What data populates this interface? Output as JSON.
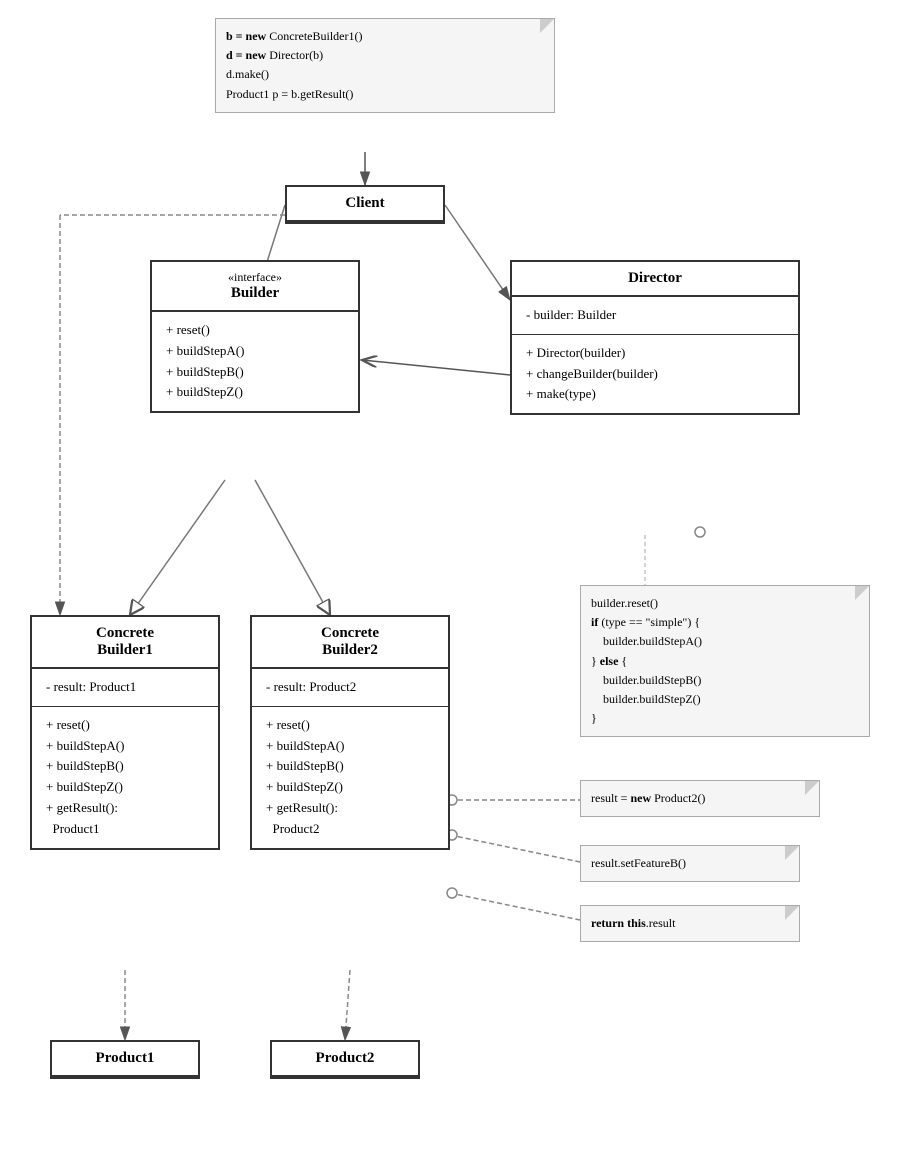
{
  "client": {
    "label": "Client"
  },
  "director": {
    "label": "Director",
    "field": "- builder: Builder",
    "methods": [
      "+ Director(builder)",
      "+ changeBuilder(builder)",
      "+ make(type)"
    ]
  },
  "builder": {
    "stereotype": "«interface»",
    "label": "Builder",
    "methods": [
      "+ reset()",
      "+ buildStepA()",
      "+ buildStepB()",
      "+ buildStepZ()"
    ]
  },
  "cb1": {
    "label": "Concrete\nBuilder1",
    "field": "- result: Product1",
    "methods": [
      "+ reset()",
      "+ buildStepA()",
      "+ buildStepB()",
      "+ buildStepZ()",
      "+ getResult():\n  Product1"
    ]
  },
  "cb2": {
    "label": "Concrete\nBuilder2",
    "field": "- result: Product2",
    "methods": [
      "+ reset()",
      "+ buildStepA()",
      "+ buildStepB()",
      "+ buildStepZ()",
      "+ getResult():\n  Product2"
    ]
  },
  "product1": {
    "label": "Product1"
  },
  "product2": {
    "label": "Product2"
  },
  "client_note": {
    "lines": [
      "b = new ConcreteBuilder1()",
      "d = new Director(b)",
      "d.make()",
      "Product1 p = b.getResult()"
    ]
  },
  "director_note": {
    "lines": [
      "builder.reset()",
      "if (type == \"simple\") {",
      "    builder.buildStepA()",
      "} else {",
      "    builder.buildStepB()",
      "    builder.buildStepZ()",
      "}"
    ],
    "bold_parts": [
      "if",
      "else"
    ]
  },
  "note_reset": {
    "text": "result = new Product2()"
  },
  "note_featureB": {
    "text": "result.setFeatureB()"
  },
  "note_return": {
    "text": "return this.result"
  }
}
